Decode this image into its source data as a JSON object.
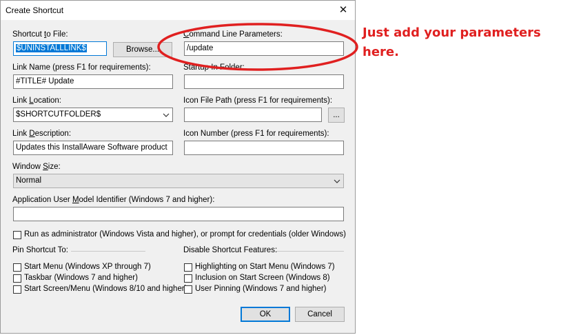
{
  "dialog": {
    "title": "Create Shortcut",
    "close_glyph": "✕"
  },
  "shortcut_to_file": {
    "label_pre": "Shortcut ",
    "label_u": "t",
    "label_post": "o File:",
    "value": "$UNINSTALLLINK$"
  },
  "browse_button": {
    "label": "Browse..."
  },
  "command_line": {
    "label_u": "C",
    "label_post": "ommand Line Parameters:",
    "value": "/update"
  },
  "link_name": {
    "label": "Link Name (press F1 for requirements):",
    "value": "#TITLE# Update"
  },
  "startup_folder": {
    "label": "Startup In Folder:",
    "value": ""
  },
  "link_location": {
    "label_pre": "Link ",
    "label_u": "L",
    "label_post": "ocation:",
    "value": "$SHORTCUTFOLDER$"
  },
  "icon_file_path": {
    "label": "Icon File Path (press F1 for requirements):",
    "value": "",
    "browse_label": "..."
  },
  "link_description": {
    "label_pre": "Link ",
    "label_u": "D",
    "label_post": "escription:",
    "value": "Updates this InstallAware Software product"
  },
  "icon_number": {
    "label": "Icon Number (press F1 for requirements):",
    "value": ""
  },
  "window_size": {
    "label_pre": "Window ",
    "label_u": "S",
    "label_post": "ize:",
    "value": "Normal"
  },
  "app_user_model": {
    "label_pre": "Application User ",
    "label_u": "M",
    "label_post": "odel Identifier (Windows 7 and higher):",
    "value": ""
  },
  "run_as_admin": {
    "label": "Run as administrator (Windows Vista and higher), or prompt for credentials (older Windows)",
    "checked": false
  },
  "pin_section": {
    "title": "Pin Shortcut To:",
    "items": [
      {
        "label": "Start Menu (Windows XP through 7)",
        "checked": false
      },
      {
        "label": "Taskbar (Windows 7 and higher)",
        "checked": false
      },
      {
        "label": "Start Screen/Menu (Windows 8/10 and higher)",
        "checked": false
      }
    ]
  },
  "disable_section": {
    "title": "Disable Shortcut Features:",
    "items": [
      {
        "label": "Highlighting on Start Menu (Windows 7)",
        "checked": false
      },
      {
        "label": "Inclusion on Start Screen (Windows 8)",
        "checked": false
      },
      {
        "label": "User Pinning (Windows 7 and higher)",
        "checked": false
      }
    ]
  },
  "ok_button": {
    "label": "OK"
  },
  "cancel_button": {
    "label": "Cancel"
  },
  "annotation": {
    "line1": "Just add your parameters",
    "line2": "here.",
    "color": "#e02020"
  }
}
